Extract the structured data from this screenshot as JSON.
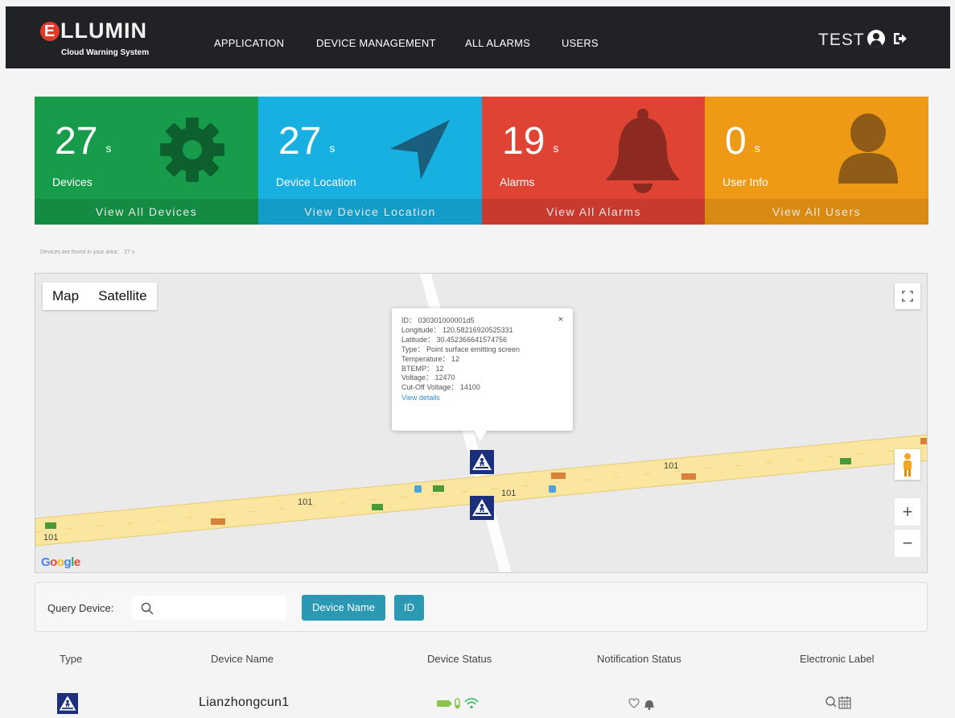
{
  "brand": {
    "name": "LLUMIN",
    "initial": "E",
    "subtitle": "Cloud Warning System"
  },
  "nav": {
    "links": [
      "APPLICATION",
      "DEVICE MANAGEMENT",
      "ALL ALARMS",
      "USERS"
    ],
    "user": "TEST",
    "icons": [
      "user-circle-icon",
      "logout-icon"
    ]
  },
  "cards": [
    {
      "value": "27",
      "unit": "s",
      "label": "Devices",
      "footer": "View All Devices",
      "icon": "gear-icon",
      "color": "#169c4b"
    },
    {
      "value": "27",
      "unit": "s",
      "label": "Device Location",
      "footer": "View Device Location",
      "icon": "location-arrow-icon",
      "color": "#17b0e0"
    },
    {
      "value": "19",
      "unit": "s",
      "label": "Alarms",
      "footer": "View All Alarms",
      "icon": "bell-icon",
      "color": "#de4334"
    },
    {
      "value": "0",
      "unit": "s",
      "label": "User Info",
      "footer": "View All Users",
      "icon": "user-icon",
      "color": "#ee9a17"
    }
  ],
  "area_note": "Devices are found in your area： 27 s",
  "map": {
    "type_buttons": [
      "Map",
      "Satellite"
    ],
    "road_labels": [
      "101",
      "101",
      "101",
      "101"
    ],
    "attribution": "Google",
    "zoom_in": "+",
    "zoom_out": "−",
    "popup": {
      "lines": [
        "ID： 030301000001d5",
        "Longitude： 120.58216920525331",
        "Latitude： 30.452366641574756",
        "Type： Point surface emitting screen",
        "Temperature： 12",
        "BTEMP： 12",
        "Voltage： 12470",
        "Cut-Off Voltage： 14100"
      ],
      "link": "View details",
      "close": "×"
    }
  },
  "query": {
    "label": "Query Device:",
    "value": "",
    "buttons": [
      "Device Name",
      "ID"
    ]
  },
  "table": {
    "headers": [
      "Type",
      "Device Name",
      "Device Status",
      "Notification Status",
      "Electronic Label"
    ],
    "rows": [
      {
        "name": "Lianzhongcun1"
      }
    ]
  },
  "colors": {
    "navbar": "#212226",
    "accent": "#2a9ab4",
    "marker": "#1c2f7c",
    "road": "#fbe6a0"
  }
}
